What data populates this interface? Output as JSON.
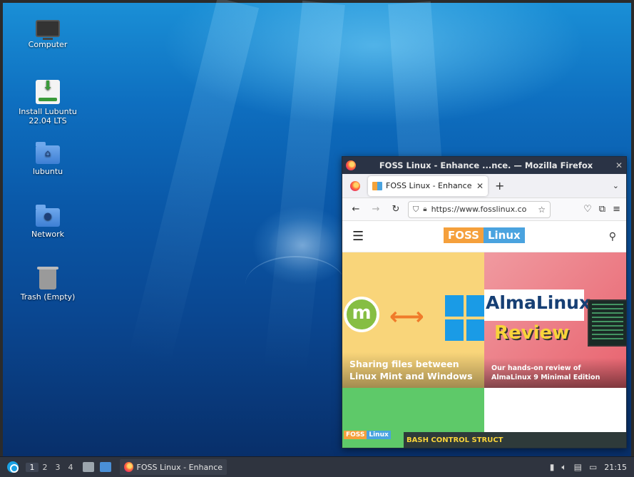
{
  "desktop": {
    "icons": [
      {
        "label": "Computer"
      },
      {
        "label": "Install Lubuntu\n22.04 LTS"
      },
      {
        "label": "lubuntu"
      },
      {
        "label": "Network"
      },
      {
        "label": "Trash (Empty)"
      }
    ]
  },
  "firefox": {
    "window_title": "FOSS Linux - Enhance ...nce. — Mozilla Firefox",
    "close_glyph": "✕",
    "tab": {
      "label": "FOSS Linux - Enhance yo",
      "close_glyph": "✕"
    },
    "new_tab_glyph": "+",
    "tab_list_glyph": "⌄",
    "nav": {
      "back": "←",
      "forward": "→",
      "reload": "↻"
    },
    "url": "https://www.fosslinux.co",
    "site": {
      "logo_left": "FOSS",
      "logo_right": "Linux",
      "cards": [
        {
          "caption": "Sharing files between Linux Mint and Windows"
        },
        {
          "caption": "Our hands-on review of AlmaLinux 9 Minimal Edition",
          "banner": "AlmaLinux",
          "banner_sub": "Review"
        },
        {
          "mini_logo_left": "FOSS",
          "mini_logo_right": "Linux",
          "banner": "BASH CONTROL STRUCT"
        }
      ]
    }
  },
  "taskbar": {
    "workspaces": [
      "1",
      "2",
      "3",
      "4"
    ],
    "active_workspace": "1",
    "task_label": "FOSS Linux - Enhance ...",
    "clock": "21:15"
  },
  "colors": {
    "foss_orange": "#f5a03c",
    "foss_blue": "#4aa3df",
    "taskbar": "#2f343f",
    "titlebar": "#2a3345"
  }
}
